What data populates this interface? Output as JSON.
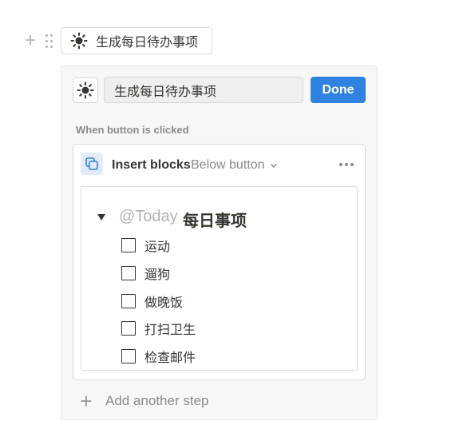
{
  "button": {
    "label": "生成每日待办事项",
    "icon": "sun-icon"
  },
  "editor": {
    "name_value": "生成每日待办事项",
    "done_label": "Done",
    "section_label": "When button is clicked",
    "accent_color": "#2f82e0"
  },
  "step": {
    "title": "Insert blocks",
    "target": "Below button",
    "icon": "copy-blocks-icon"
  },
  "content": {
    "mention": "@Today",
    "heading": "每日事项",
    "todos": [
      {
        "label": "运动",
        "checked": false
      },
      {
        "label": "遛狗",
        "checked": false
      },
      {
        "label": "做晚饭",
        "checked": false
      },
      {
        "label": "打扫卫生",
        "checked": false
      },
      {
        "label": "检查邮件",
        "checked": false
      }
    ]
  },
  "footer": {
    "add_step_label": "Add another step"
  }
}
